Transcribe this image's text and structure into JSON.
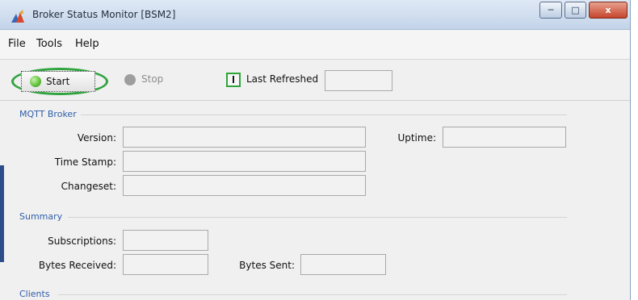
{
  "window": {
    "title": "Broker Status Monitor [BSM2]",
    "controls": {
      "close_glyph": "x"
    }
  },
  "menubar": {
    "items": [
      "File",
      "Tools",
      "Help"
    ]
  },
  "toolbar": {
    "start_label": "Start",
    "stop_label": "Stop",
    "last_refreshed_label": "Last Refreshed",
    "last_refreshed_value": "",
    "highlight_color": "#2fa43f"
  },
  "mqtt_broker": {
    "title": "MQTT Broker",
    "version_label": "Version:",
    "version_value": "",
    "uptime_label": "Uptime:",
    "uptime_value": "",
    "timestamp_label": "Time Stamp:",
    "timestamp_value": "",
    "changeset_label": "Changeset:",
    "changeset_value": ""
  },
  "summary": {
    "title": "Summary",
    "subscriptions_label": "Subscriptions:",
    "subscriptions_value": "",
    "bytes_received_label": "Bytes Received:",
    "bytes_received_value": "",
    "bytes_sent_label": "Bytes Sent:",
    "bytes_sent_value": ""
  },
  "clients": {
    "title": "Clients"
  },
  "icons": {
    "app": "broker-app-icon",
    "start": "green-dot-icon",
    "stop": "gray-dot-icon",
    "refresh": "timer-icon"
  },
  "colors": {
    "section_title": "#2f5fa8",
    "start_dot": "#5cbf35",
    "stop_dot": "#9e9e9e"
  }
}
